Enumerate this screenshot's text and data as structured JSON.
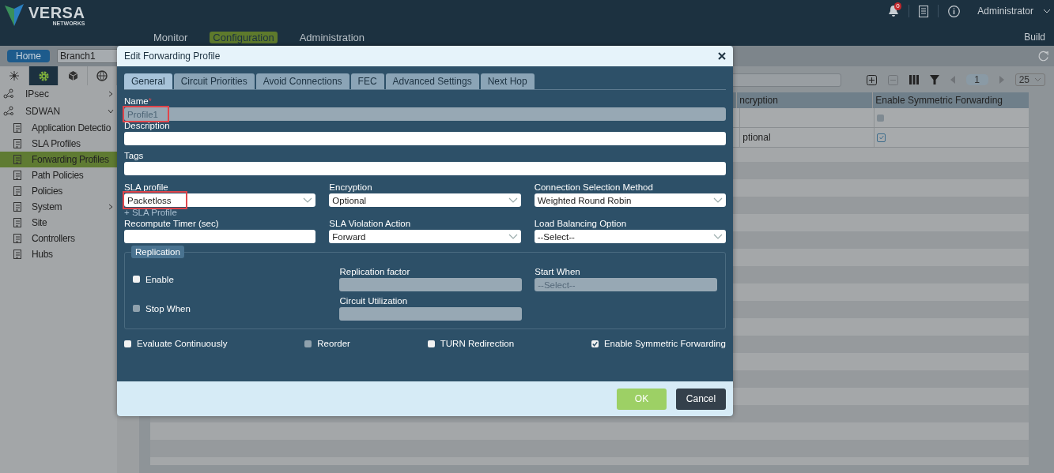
{
  "header": {
    "logo": "VERSA",
    "logo_sub": "NETWORKS",
    "notification_count": "0",
    "user": "Administrator",
    "build": "Build",
    "nav": [
      {
        "label": "Monitor",
        "selected": false
      },
      {
        "label": "Configuration",
        "selected": true
      },
      {
        "label": "Administration",
        "selected": false
      }
    ]
  },
  "context_bar": {
    "home": "Home",
    "branch": "Branch1"
  },
  "sidebar": {
    "tabs": [
      {
        "selected": false
      },
      {
        "selected": true
      },
      {
        "selected": false
      },
      {
        "selected": false
      }
    ],
    "items": [
      {
        "label": "IPsec",
        "expanded": false
      },
      {
        "label": "SDWAN",
        "expanded": true,
        "children": [
          {
            "label": "Application Detectio",
            "selected": false
          },
          {
            "label": "SLA Profiles",
            "selected": false
          },
          {
            "label": "Forwarding Profiles",
            "selected": true
          },
          {
            "label": "Path Policies",
            "selected": false
          },
          {
            "label": "Policies",
            "selected": false
          },
          {
            "label": "System",
            "selected": false,
            "expandable": true
          },
          {
            "label": "Site",
            "selected": false
          },
          {
            "label": "Controllers",
            "selected": false
          },
          {
            "label": "Hubs",
            "selected": false
          }
        ]
      }
    ]
  },
  "table": {
    "page": "1",
    "page_size": "25",
    "columns": [
      "ncryption",
      "Enable Symmetric Forwarding"
    ],
    "rows": [
      {
        "column_1": "",
        "checked": false
      },
      {
        "column_1": "ptional",
        "checked": true
      }
    ]
  },
  "dialog": {
    "title": "Edit Forwarding Profile",
    "tabs": [
      {
        "label": "General",
        "selected": true
      },
      {
        "label": "Circuit Priorities",
        "selected": false
      },
      {
        "label": "Avoid Connections",
        "selected": false
      },
      {
        "label": "FEC",
        "selected": false
      },
      {
        "label": "Advanced Settings",
        "selected": false
      },
      {
        "label": "Next Hop",
        "selected": false
      }
    ],
    "name": {
      "label": "Name",
      "required_mark": "*",
      "value": "Profile1",
      "disabled": true,
      "highlighted": true
    },
    "description": {
      "label": "Description"
    },
    "tags": {
      "label": "Tags"
    },
    "selects": [
      {
        "label": "SLA profile",
        "value": "Packetloss",
        "highlighted": true
      },
      {
        "label": "Encryption",
        "value": "Optional",
        "highlighted": false
      },
      {
        "label": "Connection Selection Method",
        "value": "Weighted Round Robin",
        "highlighted": false
      }
    ],
    "add_link": "+ SLA Profile",
    "row2": [
      {
        "kind": "text",
        "label": "Recompute Timer (sec)"
      },
      {
        "kind": "select",
        "label": "SLA Violation Action",
        "value": "Forward"
      },
      {
        "kind": "select",
        "label": "Load Balancing Option",
        "value": "--Select--"
      }
    ],
    "replication": {
      "legend": "Replication",
      "enable": {
        "label": "Enable",
        "checked": false,
        "disabled": false
      },
      "stop_when": {
        "label": "Stop When",
        "checked": false,
        "disabled": true
      },
      "factor": {
        "label": "Replication factor",
        "disabled": true
      },
      "start_when": {
        "label": "Start When",
        "placeholder": "--Select--",
        "disabled": true
      },
      "utilization": {
        "label": "Circuit Utilization",
        "disabled": true
      }
    },
    "options": [
      {
        "label": "Evaluate Continuously",
        "checked": false,
        "disabled": false
      },
      {
        "label": "Reorder",
        "checked": false,
        "disabled": true
      },
      {
        "label": "TURN Redirection",
        "checked": false,
        "disabled": false
      },
      {
        "label": "Enable Symmetric Forwarding",
        "checked": true,
        "disabled": false
      }
    ],
    "buttons": [
      {
        "label": "OK",
        "kind": "primary"
      },
      {
        "label": "Cancel",
        "kind": "secondary"
      }
    ]
  }
}
